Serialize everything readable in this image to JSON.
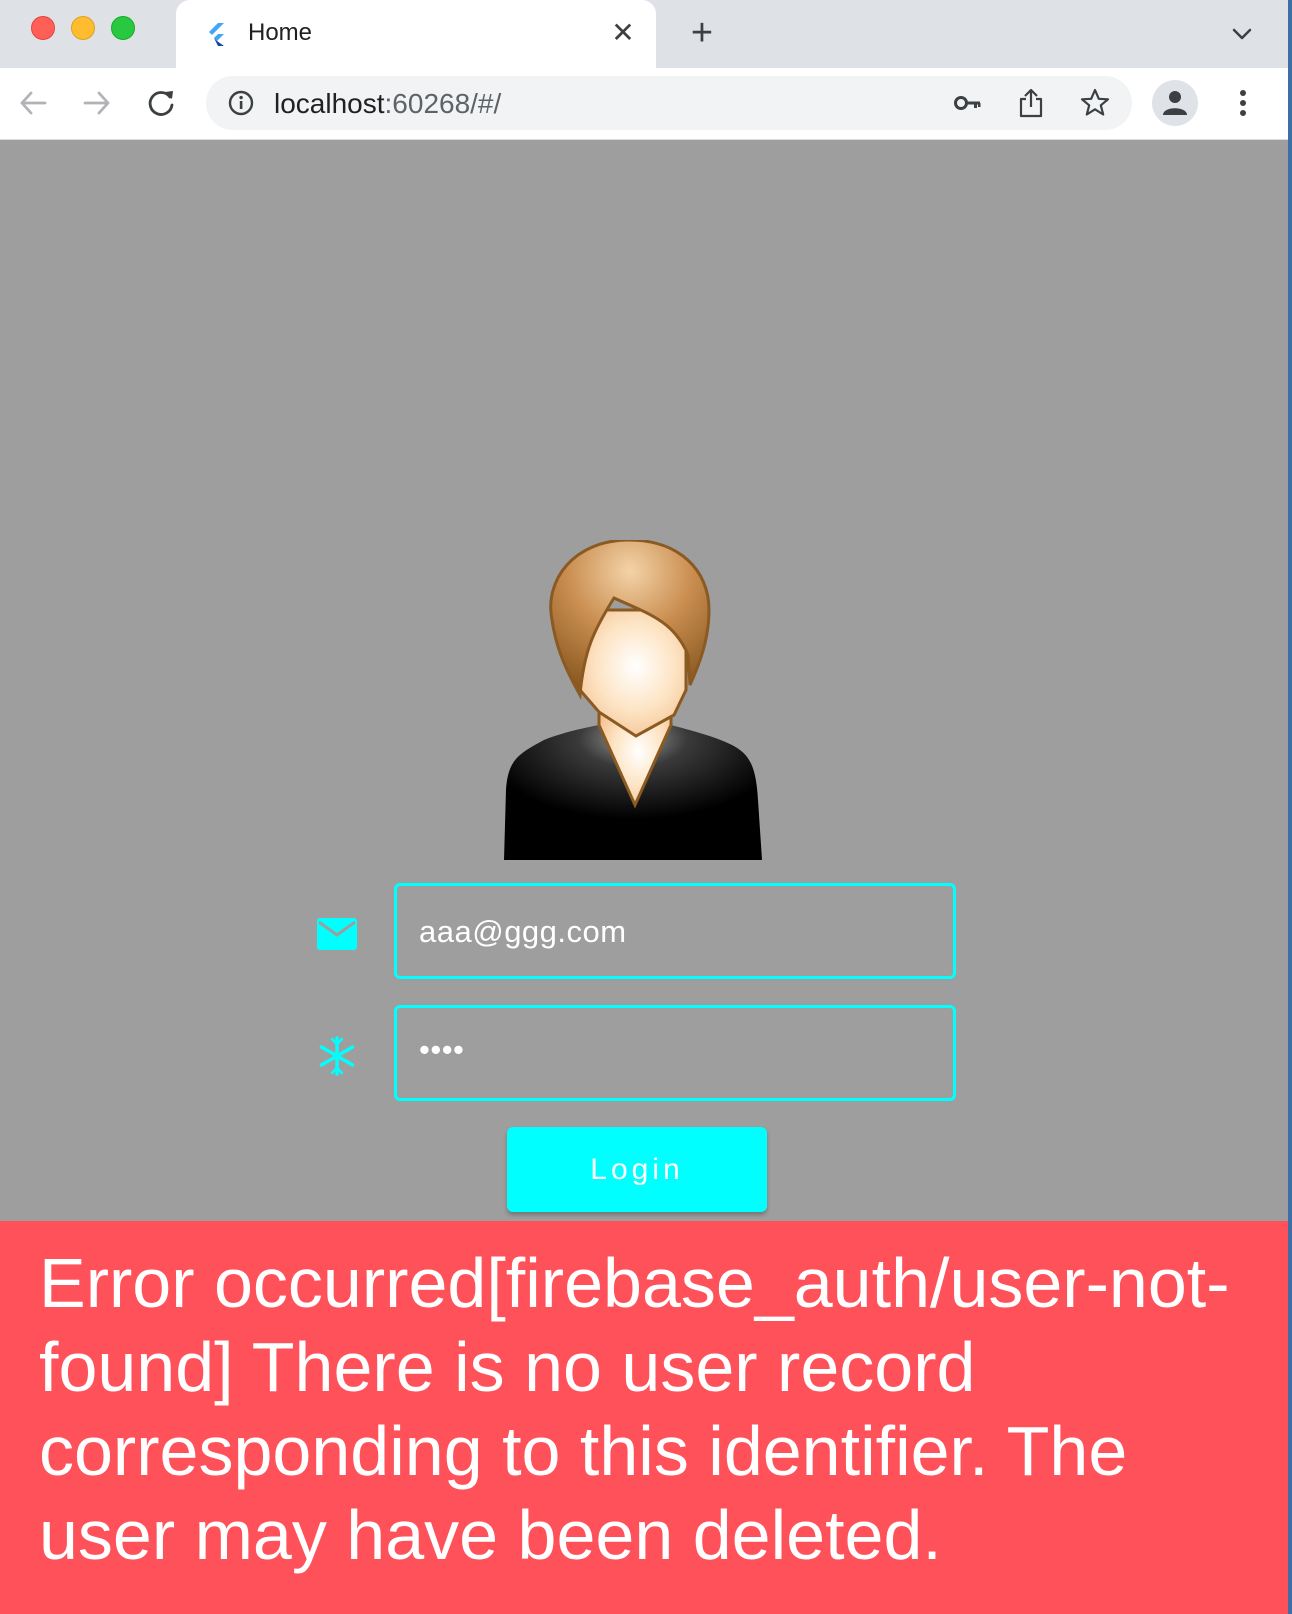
{
  "browser": {
    "tab": {
      "title": "Home",
      "favicon": "flutter-icon"
    },
    "new_tab_label": "+",
    "address": {
      "host": "localhost",
      "rest": ":60268/#/"
    },
    "colors": {
      "tabstrip": "#dee1e6",
      "toolbar": "#ffffff",
      "omnibox": "#f1f3f4"
    }
  },
  "page": {
    "background": "#9e9e9e",
    "avatar_image": "person-avatar",
    "email_field": {
      "value": "aaa@ggg.com",
      "icon": "mail-icon"
    },
    "password_field": {
      "value": "••••",
      "icon": "asterisk-icon"
    },
    "login_button": {
      "label": "Login",
      "color": "#00ffff"
    },
    "snackbar": {
      "message": "Error occurred[firebase_auth/user-not-found] There is no user record corresponding to this identifier. The user may have been deleted.",
      "color": "#ff5159"
    }
  }
}
